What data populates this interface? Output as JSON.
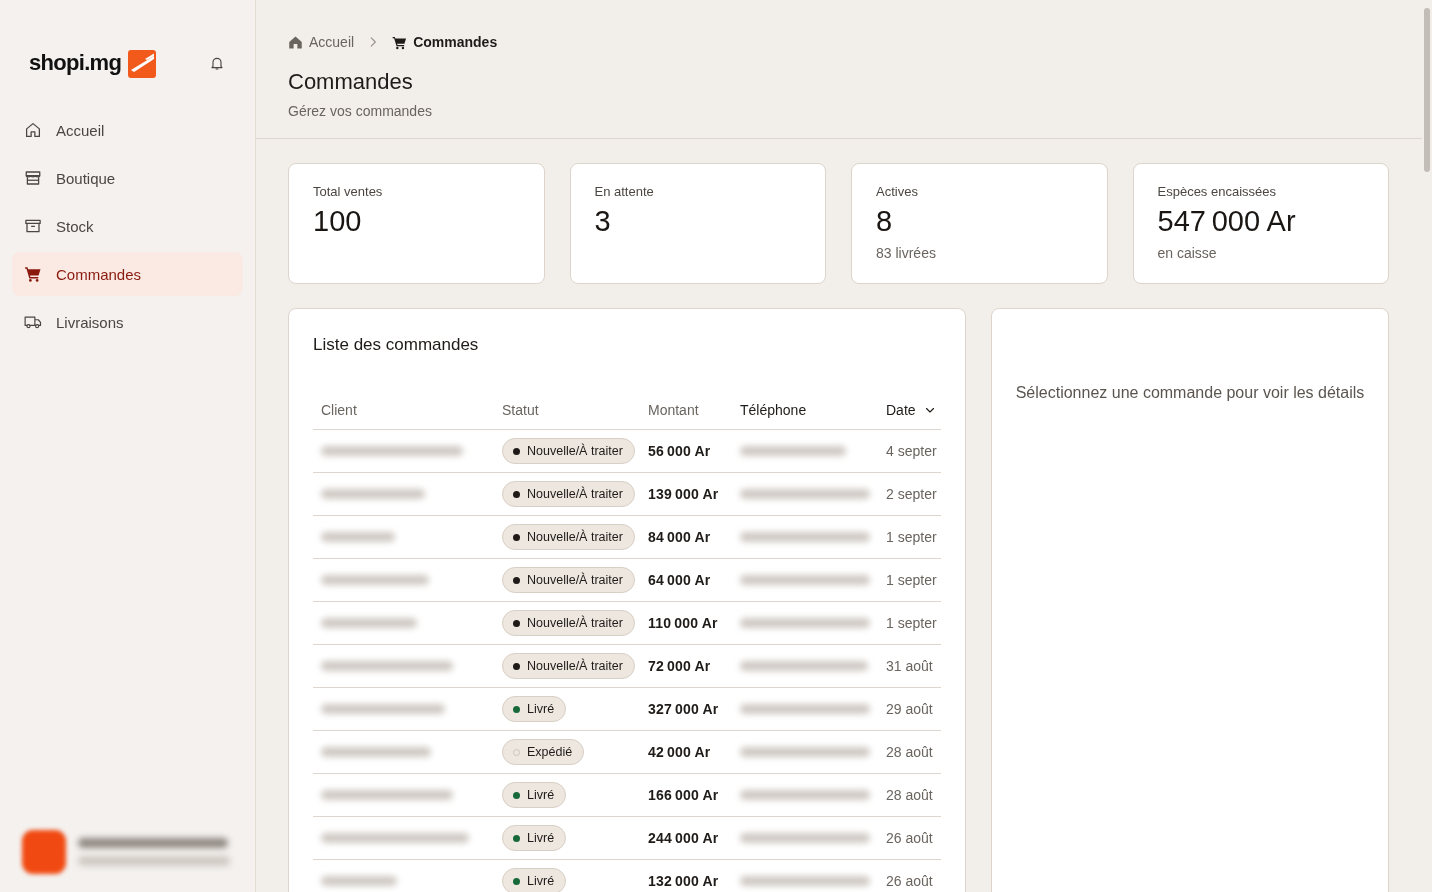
{
  "sidebar": {
    "logo": "shopi.mg",
    "nav": [
      {
        "label": "Accueil",
        "selected": false
      },
      {
        "label": "Boutique",
        "selected": false
      },
      {
        "label": "Stock",
        "selected": false
      },
      {
        "label": "Commandes",
        "selected": true
      },
      {
        "label": "Livraisons",
        "selected": false
      }
    ]
  },
  "breadcrumb": [
    {
      "label": "Accueil",
      "current": false
    },
    {
      "label": "Commandes",
      "current": true
    }
  ],
  "page": {
    "title": "Commandes",
    "subtitle": "Gérez vos commandes"
  },
  "stats": [
    {
      "label": "Total ventes",
      "value": "100"
    },
    {
      "label": "En attente",
      "value": "3"
    },
    {
      "label": "Actives",
      "value": "8",
      "note": "83 livrées"
    },
    {
      "label": "Espèces encaissées",
      "value": "547 000 Ar",
      "note": "en caisse"
    }
  ],
  "orders": {
    "title": "Liste des commandes",
    "columns": [
      {
        "label": "Client",
        "emphasized": false,
        "sorted": false
      },
      {
        "label": "Statut",
        "emphasized": false,
        "sorted": false
      },
      {
        "label": "Montant",
        "emphasized": false,
        "sorted": false
      },
      {
        "label": "Téléphone",
        "emphasized": true,
        "sorted": false
      },
      {
        "label": "Date",
        "emphasized": true,
        "sorted": true
      }
    ],
    "rows": [
      {
        "status": {
          "label": "Nouvelle/À traiter",
          "color": "#1f1a17",
          "hollow": false
        },
        "amount": "56 000 Ar",
        "date": "4 septer"
      },
      {
        "status": {
          "label": "Nouvelle/À traiter",
          "color": "#1f1a17",
          "hollow": false
        },
        "amount": "139 000 Ar",
        "date": "2 septer"
      },
      {
        "status": {
          "label": "Nouvelle/À traiter",
          "color": "#1f1a17",
          "hollow": false
        },
        "amount": "84 000 Ar",
        "date": "1 septer"
      },
      {
        "status": {
          "label": "Nouvelle/À traiter",
          "color": "#1f1a17",
          "hollow": false
        },
        "amount": "64 000 Ar",
        "date": "1 septer"
      },
      {
        "status": {
          "label": "Nouvelle/À traiter",
          "color": "#1f1a17",
          "hollow": false
        },
        "amount": "110 000 Ar",
        "date": "1 septer"
      },
      {
        "status": {
          "label": "Nouvelle/À traiter",
          "color": "#1f1a17",
          "hollow": false
        },
        "amount": "72 000 Ar",
        "date": "31 août"
      },
      {
        "status": {
          "label": "Livré",
          "color": "#17693a",
          "hollow": false
        },
        "amount": "327 000 Ar",
        "date": "29 août"
      },
      {
        "status": {
          "label": "Expédié",
          "color": "#cdc4ba",
          "hollow": true
        },
        "amount": "42 000 Ar",
        "date": "28 août"
      },
      {
        "status": {
          "label": "Livré",
          "color": "#17693a",
          "hollow": false
        },
        "amount": "166 000 Ar",
        "date": "28 août"
      },
      {
        "status": {
          "label": "Livré",
          "color": "#17693a",
          "hollow": false
        },
        "amount": "244 000 Ar",
        "date": "26 août"
      },
      {
        "status": {
          "label": "Livré",
          "color": "#17693a",
          "hollow": false
        },
        "amount": "132 000 Ar",
        "date": "26 août"
      }
    ]
  },
  "details": {
    "message": "Sélectionnez une commande pour voir les détails"
  }
}
